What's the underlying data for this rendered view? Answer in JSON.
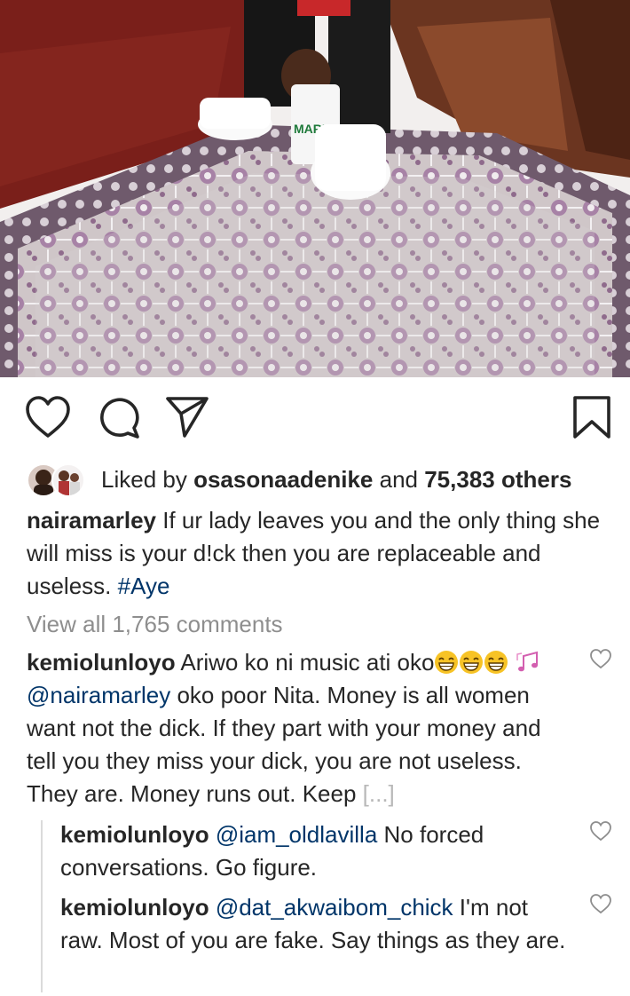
{
  "post": {
    "likes": {
      "prefix": "Liked by ",
      "user": "osasonaadenike",
      "middle": " and ",
      "count": "75,383 others"
    },
    "caption": {
      "username": "nairamarley",
      "text": " If ur lady leaves you and the only thing she will miss is your d!ck then you are replaceable and useless. ",
      "hashtag": "#Aye"
    },
    "view_all": "View all 1,765 comments"
  },
  "comments": [
    {
      "username": "kemiolunloyo",
      "text_1": " Ariwo ko ni music ati oko",
      "mention": "@nairamarley",
      "text_2": " oko poor Nita. Money is all women want not the dick. If they part with your money and tell you they miss your dick, you are not useless. They are. Money runs out. Keep ",
      "more": "[...]"
    }
  ],
  "replies": [
    {
      "username": "kemiolunloyo",
      "mention": "@iam_oldlavilla",
      "text": " No forced conversations. Go figure."
    },
    {
      "username": "kemiolunloyo",
      "mention": "@dat_akwaibom_chick",
      "text": " I'm not raw. Most of you are fake. Say things as they are."
    }
  ],
  "colors": {
    "text": "#262626",
    "link": "#003569",
    "muted": "#8e8e8e"
  },
  "icons": [
    "heart-icon",
    "comment-icon",
    "share-icon",
    "bookmark-icon",
    "emoji-grin-icon",
    "music-notes-icon"
  ]
}
